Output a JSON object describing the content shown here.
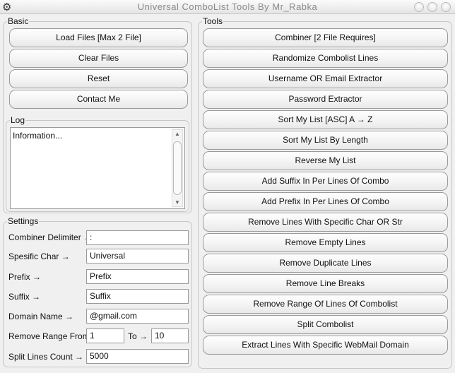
{
  "window": {
    "title": "Universal ComboList Tools By Mr_Rabka"
  },
  "basic": {
    "label": "Basic",
    "buttons": [
      "Load Files [Max 2 File]",
      "Clear Files",
      "Reset",
      "Contact Me"
    ]
  },
  "log": {
    "label": "Log",
    "text": "Information..."
  },
  "settings": {
    "label": "Settings",
    "combiner_delimiter": {
      "label": "Combiner Delimiter →",
      "value": ":"
    },
    "specific_char": {
      "label": "Spesific Char →",
      "value": "Universal"
    },
    "prefix": {
      "label": "Prefix →",
      "value": "Prefix"
    },
    "suffix": {
      "label": "Suffix →",
      "value": "Suffix"
    },
    "domain": {
      "label": "Domain Name →",
      "value": "@gmail.com"
    },
    "range": {
      "label": "Remove Range From :",
      "from": "1",
      "to_label": "To →",
      "to": "10"
    },
    "split": {
      "label": "Split Lines Count →",
      "value": "5000"
    }
  },
  "tools": {
    "label": "Tools",
    "buttons": [
      "Combiner [2 File Requires]",
      "Randomize Combolist Lines",
      "Username OR Email Extractor",
      "Password Extractor",
      "Sort My List [ASC] A → Z",
      "Sort My List By Length",
      "Reverse My List",
      "Add Suffix In Per Lines Of Combo",
      "Add Prefix In Per Lines Of Combo",
      "Remove Lines With Specific Char OR Str",
      "Remove Empty Lines",
      "Remove Duplicate Lines",
      "Remove Line Breaks",
      "Remove Range Of Lines Of Combolist",
      "Split Combolist",
      "Extract Lines With Specific WebMail Domain"
    ]
  }
}
